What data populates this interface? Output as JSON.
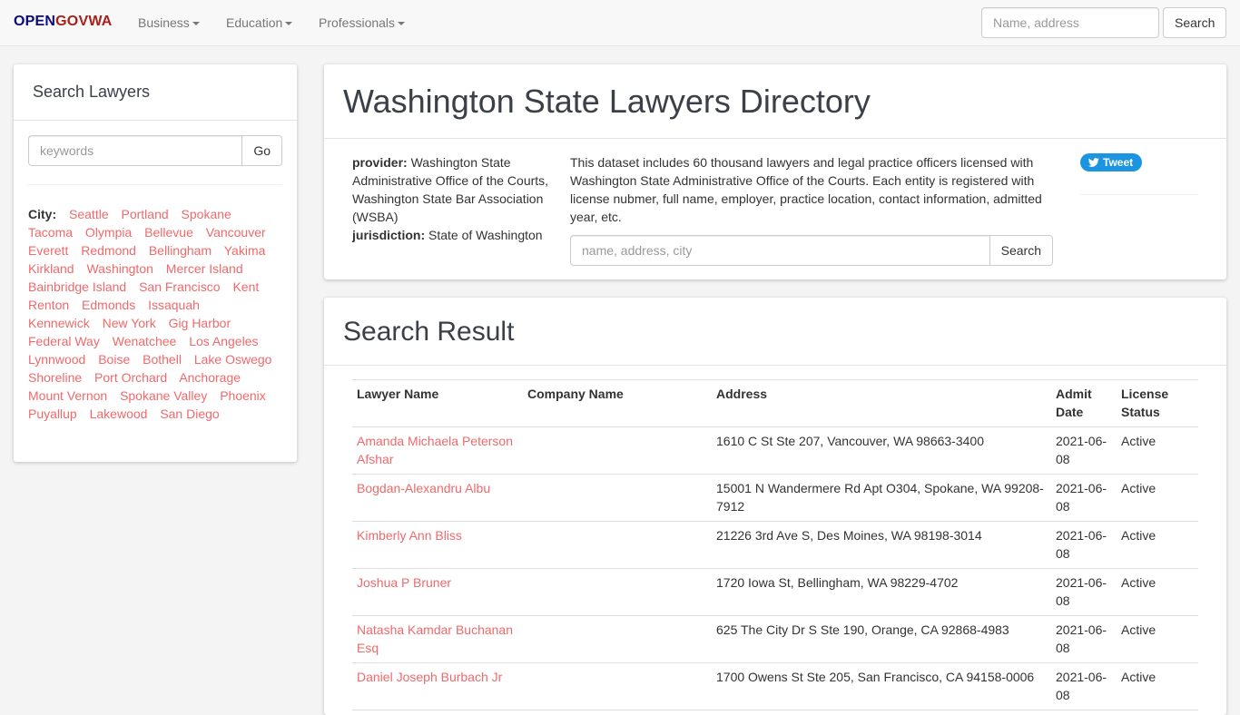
{
  "navbar": {
    "brand_part1": "OPEN",
    "brand_part2": "GOVWA",
    "menus": [
      {
        "label": "Business"
      },
      {
        "label": "Education"
      },
      {
        "label": "Professionals"
      }
    ],
    "search_placeholder": "Name, address",
    "search_button": "Search"
  },
  "sidebar": {
    "title": "Search Lawyers",
    "keyword_placeholder": "keywords",
    "go_button": "Go",
    "city_label": "City:",
    "cities": [
      "Seattle",
      "Portland",
      "Spokane",
      "Tacoma",
      "Olympia",
      "Bellevue",
      "Vancouver",
      "Everett",
      "Redmond",
      "Bellingham",
      "Yakima",
      "Kirkland",
      "Washington",
      "Mercer Island",
      "Bainbridge Island",
      "San Francisco",
      "Kent",
      "Renton",
      "Edmonds",
      "Issaquah",
      "Kennewick",
      "New York",
      "Gig Harbor",
      "Federal Way",
      "Wenatchee",
      "Los Angeles",
      "Lynnwood",
      "Boise",
      "Bothell",
      "Lake Oswego",
      "Shoreline",
      "Port Orchard",
      "Anchorage",
      "Mount Vernon",
      "Spokane Valley",
      "Phoenix",
      "Puyallup",
      "Lakewood",
      "San Diego"
    ]
  },
  "directory": {
    "title": "Washington State Lawyers Directory",
    "provider_label": "provider:",
    "provider_value": "Washington State Administrative Office of the Courts, Washington State Bar Association (WSBA)",
    "jurisdiction_label": "jurisdiction:",
    "jurisdiction_value": "State of Washington",
    "description": "This dataset includes 60 thousand lawyers and legal practice officers licensed with Washington State Administrative Office of the Courts. Each entity is registered with license nubmer, full name, employer, practice location, contact information, admitted year, etc.",
    "search_placeholder": "name, address, city",
    "search_button": "Search",
    "tweet_label": "Tweet"
  },
  "results": {
    "title": "Search Result",
    "columns": [
      "Lawyer Name",
      "Company Name",
      "Address",
      "Admit Date",
      "License Status"
    ],
    "rows": [
      {
        "name": "Amanda Michaela Peterson Afshar",
        "company": "",
        "address": "1610 C St Ste 207, Vancouver, WA 98663-3400",
        "admit": "2021-06-08",
        "status": "Active"
      },
      {
        "name": "Bogdan-Alexandru Albu",
        "company": "",
        "address": "15001 N Wandermere Rd Apt O304, Spokane, WA 99208-7912",
        "admit": "2021-06-08",
        "status": "Active"
      },
      {
        "name": "Kimberly Ann Bliss",
        "company": "",
        "address": "21226 3rd Ave S, Des Moines, WA 98198-3014",
        "admit": "2021-06-08",
        "status": "Active"
      },
      {
        "name": "Joshua P Bruner",
        "company": "",
        "address": "1720 Iowa St, Bellingham, WA 98229-4702",
        "admit": "2021-06-08",
        "status": "Active"
      },
      {
        "name": "Natasha Kamdar Buchanan Esq",
        "company": "",
        "address": "625 The City Dr S Ste 190, Orange, CA 92868-4983",
        "admit": "2021-06-08",
        "status": "Active"
      },
      {
        "name": "Daniel Joseph Burbach Jr",
        "company": "",
        "address": "1700 Owens St Ste 205, San Francisco, CA 94158-0006",
        "admit": "2021-06-08",
        "status": "Active"
      }
    ]
  }
}
